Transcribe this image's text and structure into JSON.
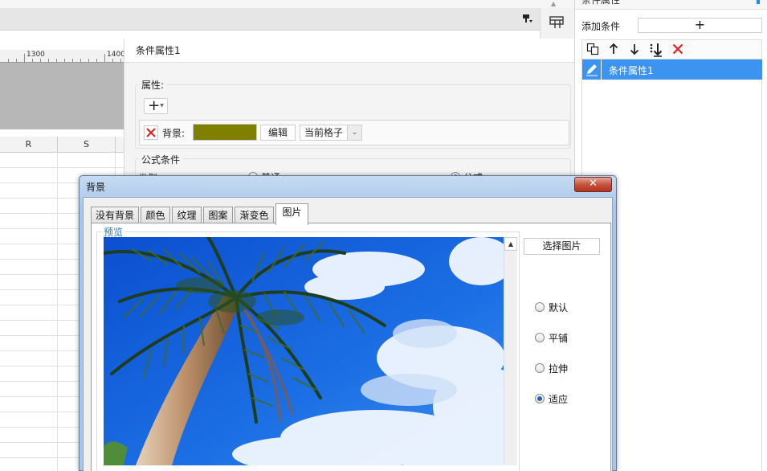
{
  "sidebar": {
    "title": "条件属性",
    "add_condition_label": "添加条件",
    "add_condition_icon": "plus-icon",
    "toolbar_icons": [
      "copy-icon",
      "arrow-up-icon",
      "arrow-down-icon",
      "move-to-bottom-icon",
      "delete-x-icon"
    ],
    "items": [
      {
        "label": "条件属性1",
        "icon": "edit-pencil-icon",
        "selected": true
      }
    ]
  },
  "ruler": {
    "labels": [
      "1300",
      "1400"
    ]
  },
  "grid": {
    "columns": [
      "R",
      "S"
    ]
  },
  "condition_panel": {
    "title": "条件属性1",
    "properties_label": "属性:",
    "property_row": {
      "name": "背景:",
      "color": "#808000",
      "edit_label": "编辑",
      "scope_value": "当前格子"
    },
    "formula_label": "公式条件",
    "type_label": "类型",
    "type_options": [
      {
        "label": "普通",
        "selected": false
      },
      {
        "label": "公式",
        "selected": true
      }
    ]
  },
  "dialog": {
    "title": "背景",
    "close_icon": "close-x-icon",
    "tabs": [
      {
        "label": "没有背景",
        "active": false
      },
      {
        "label": "颜色",
        "active": false
      },
      {
        "label": "纹理",
        "active": false
      },
      {
        "label": "图案",
        "active": false
      },
      {
        "label": "渐变色",
        "active": false
      },
      {
        "label": "图片",
        "active": true
      }
    ],
    "preview_label": "预览",
    "choose_image_label": "选择图片",
    "layout_options": [
      {
        "label": "默认",
        "selected": false
      },
      {
        "label": "平铺",
        "selected": false
      },
      {
        "label": "拉伸",
        "selected": false
      },
      {
        "label": "适应",
        "selected": true
      }
    ]
  },
  "colors": {
    "accent": "#3c94f0",
    "delete_red": "#e02020",
    "swatch": "#808000"
  }
}
